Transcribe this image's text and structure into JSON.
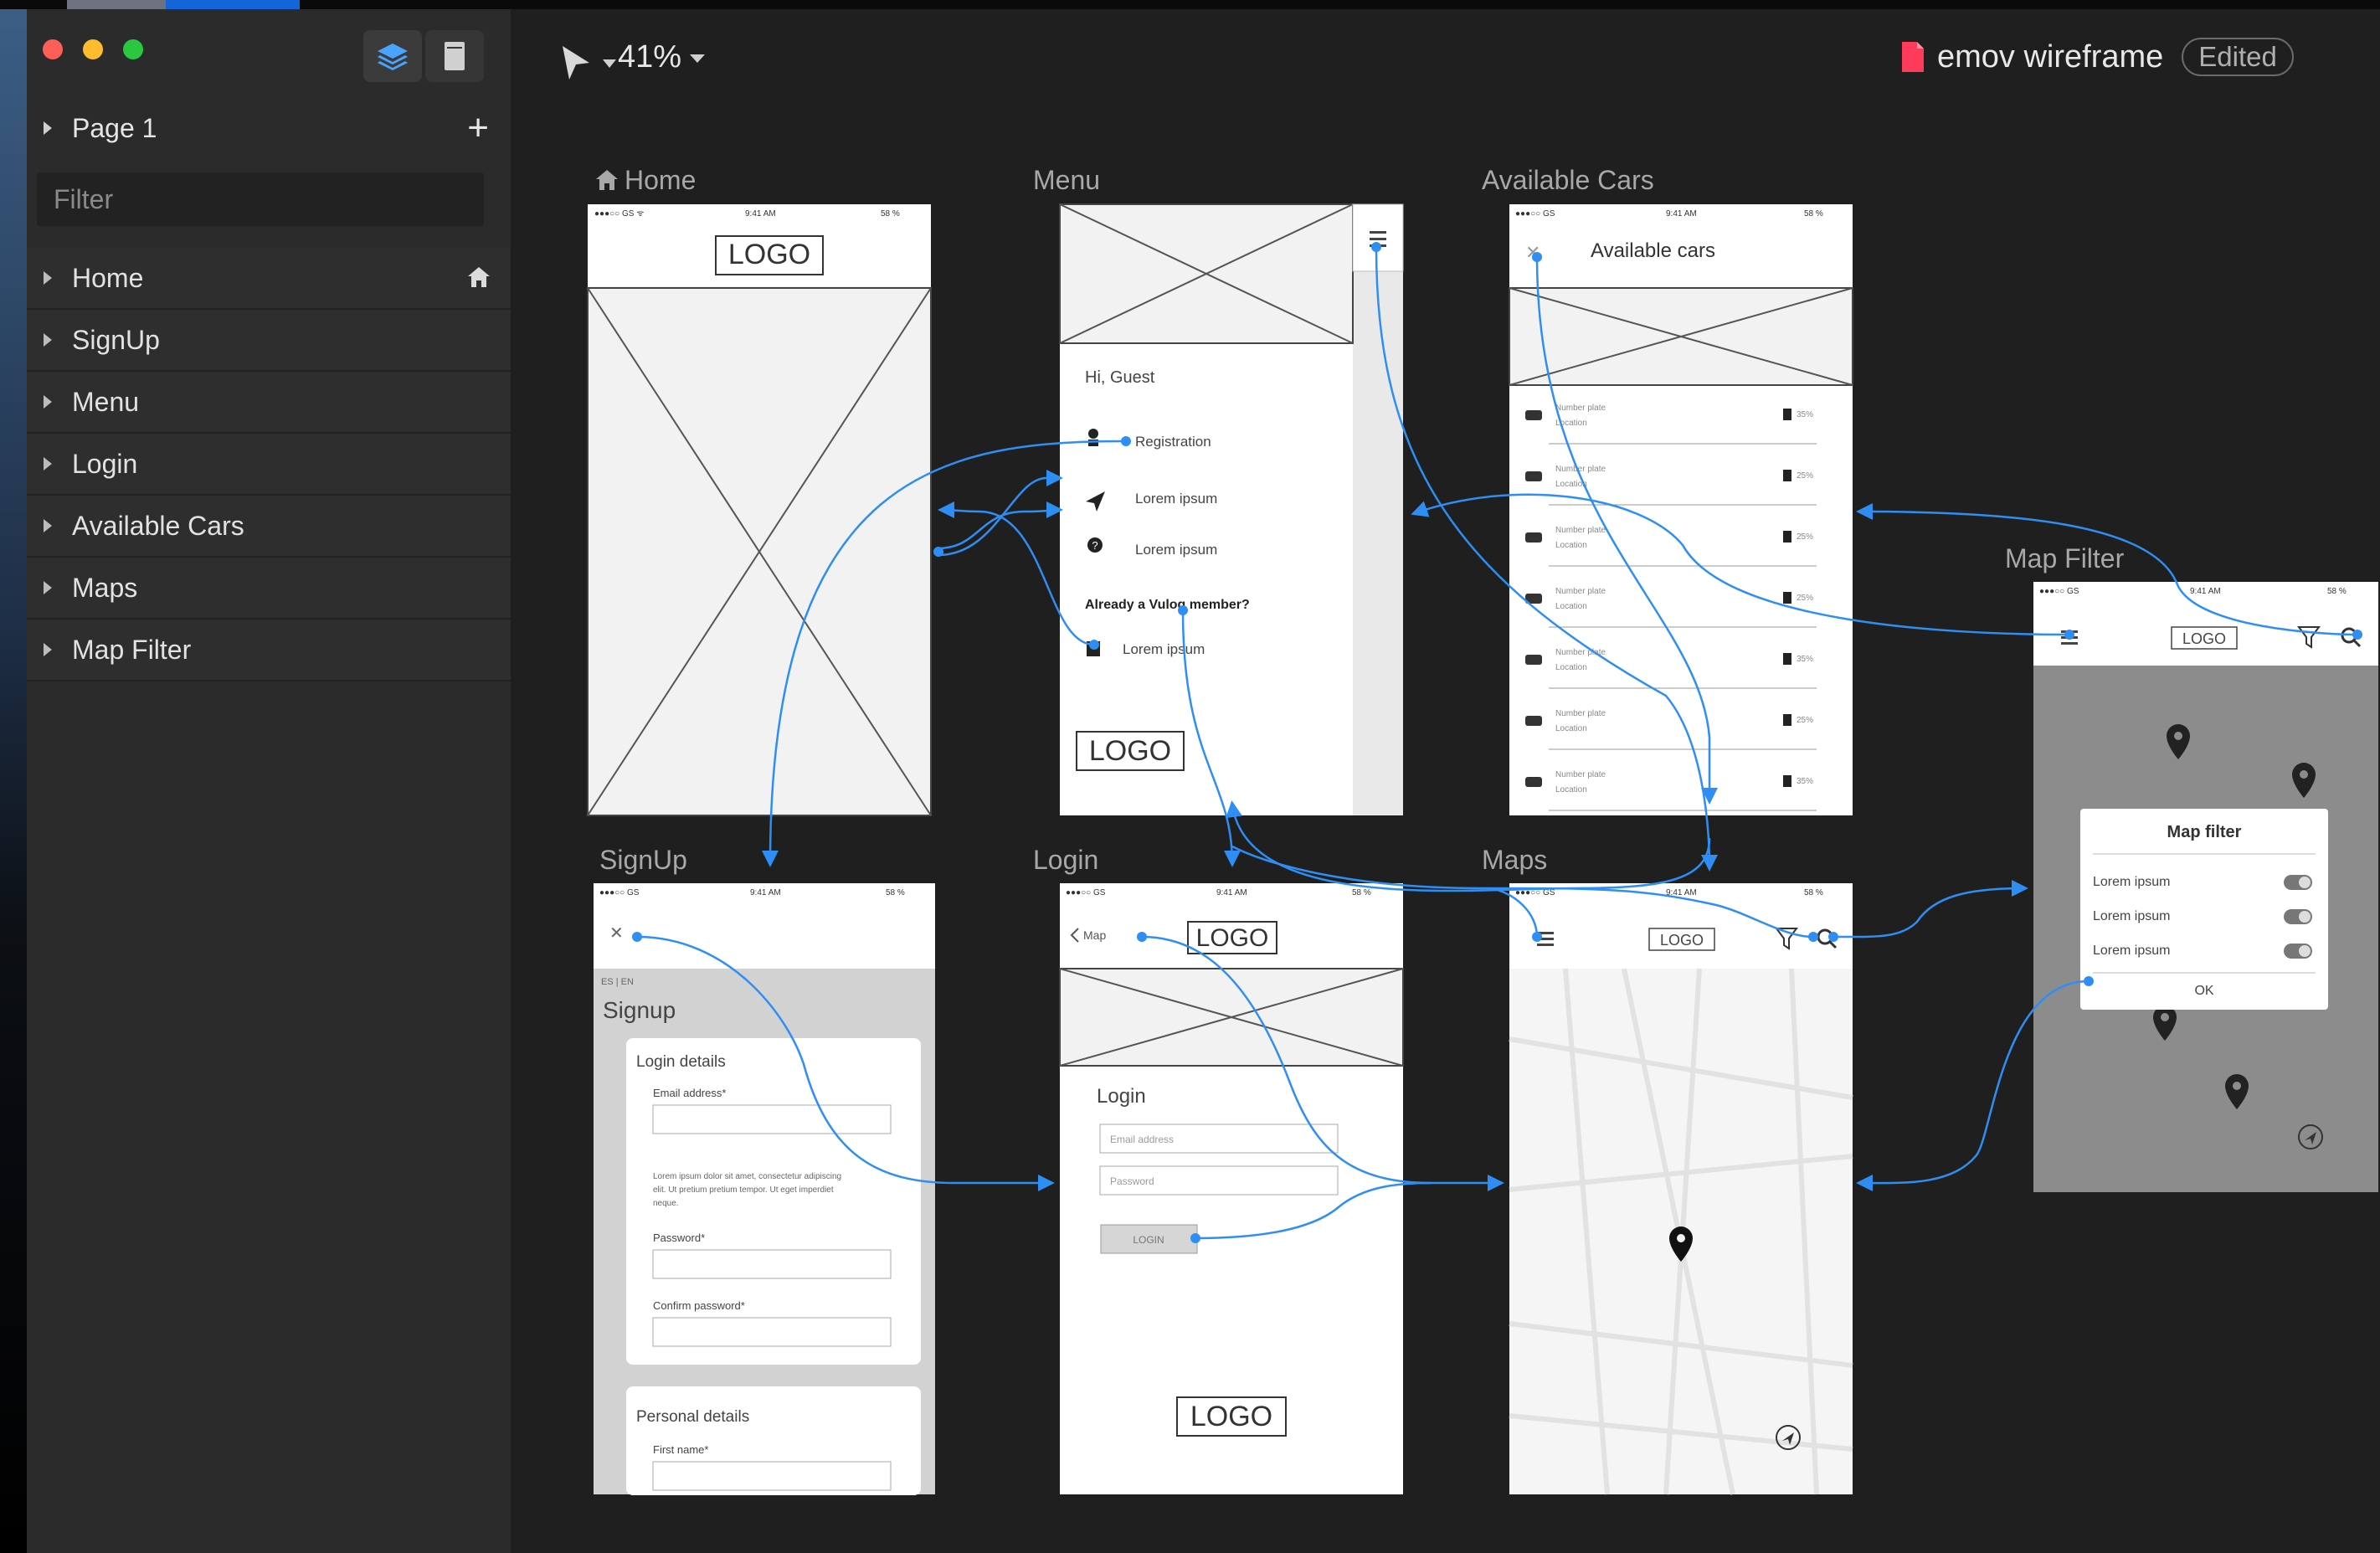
{
  "window": {
    "title": "emov wireframe",
    "status_badge": "Edited",
    "zoom": "41%"
  },
  "sidebar": {
    "page_name": "Page 1",
    "filter_placeholder": "Filter",
    "layers": [
      {
        "label": "Home",
        "is_home": true
      },
      {
        "label": "SignUp"
      },
      {
        "label": "Menu"
      },
      {
        "label": "Login"
      },
      {
        "label": "Available Cars"
      },
      {
        "label": "Maps"
      },
      {
        "label": "Map Filter"
      }
    ]
  },
  "artboards": {
    "home": {
      "title": "Home",
      "logo": "LOGO"
    },
    "menu": {
      "title": "Menu",
      "greeting": "Hi, Guest",
      "items": [
        "Registration",
        "Lorem ipsum",
        "Lorem ipsum"
      ],
      "member_question": "Already a Vulog member?",
      "member_link": "Lorem ipsum",
      "logo": "LOGO"
    },
    "available_cars": {
      "title": "Available Cars",
      "header": "Available cars",
      "car_name": "Number plate",
      "car_location": "Location",
      "fuel": [
        "35%",
        "25%",
        "25%",
        "25%",
        "35%",
        "25%",
        "35%"
      ]
    },
    "map_filter": {
      "title": "Map Filter",
      "logo": "LOGO",
      "dialog_title": "Map filter",
      "options": [
        "Lorem ipsum",
        "Lorem ipsum",
        "Lorem ipsum"
      ],
      "ok": "OK"
    },
    "signup": {
      "title": "SignUp",
      "lang": "ES | EN",
      "heading": "Signup",
      "section1": "Login details",
      "email_label": "Email address*",
      "terms": [
        "Lorem ipsum dolor sit amet, consectetur adipiscing",
        "elit. Ut pretium pretium tempor. Ut eget imperdiet",
        "neque."
      ],
      "password_label": "Password*",
      "confirm_label": "Confirm password*",
      "section2": "Personal details",
      "first_name_label": "First name*"
    },
    "login": {
      "title": "Login",
      "back_label": "Map",
      "logo": "LOGO",
      "heading": "Login",
      "email_placeholder": "Email address",
      "password_placeholder": "Password",
      "button": "LOGIN",
      "bottom_logo": "LOGO"
    },
    "maps": {
      "title": "Maps",
      "logo": "LOGO"
    }
  },
  "status_bar": {
    "carrier": "●●●○○ GS ᯤ",
    "time": "9:41 AM",
    "battery": "58 %"
  },
  "colors": {
    "accent": "#2f8ef4",
    "sidebar": "#2b2b2b",
    "canvas": "#1f1f1f"
  }
}
